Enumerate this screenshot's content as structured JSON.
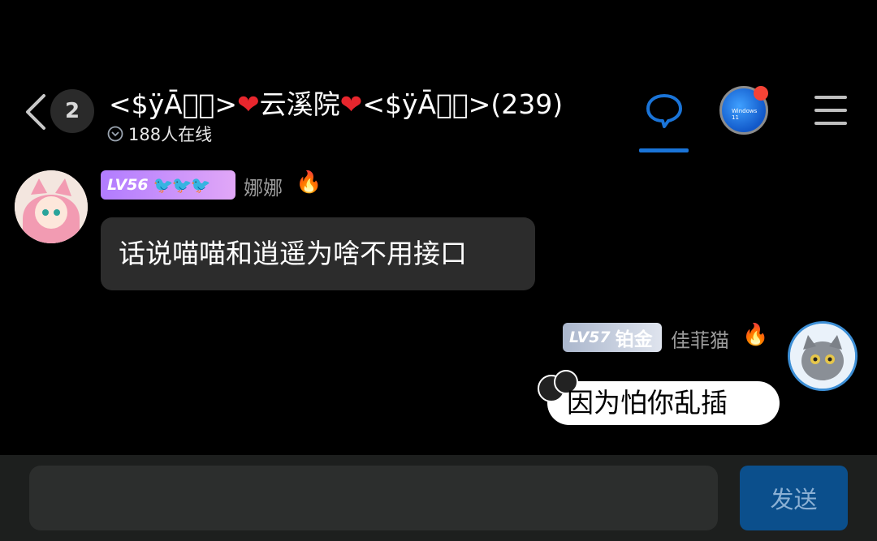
{
  "header": {
    "unread_count": "2",
    "title_prefix": "<$ÿĀ\u0000\u0000>",
    "title_name": "云溪院",
    "title_suffix": "<$ÿĀ\u0000\u0000>(239)",
    "online_text": "188人在线"
  },
  "messages": [
    {
      "side": "left",
      "level": "LV56",
      "sender": "娜娜",
      "text": "话说喵喵和逍遥为啥不用接口"
    },
    {
      "side": "right",
      "level": "LV57",
      "tier": "铂金",
      "sender": "佳菲猫",
      "text": "因为怕你乱插"
    }
  ],
  "app_avatar_label": "Windows 11",
  "composer": {
    "value": "",
    "send_label": "发送"
  },
  "colors": {
    "accent": "#1a74d8",
    "send_button": "#0b4f8c",
    "bubble_left": "#2c2c2c",
    "badge_dot": "#f44336"
  },
  "icons": [
    "back-arrow-icon",
    "chevron-down-icon",
    "chat-bubble-icon",
    "menu-icon",
    "fire-icon",
    "bird-icon",
    "heart-icon"
  ]
}
